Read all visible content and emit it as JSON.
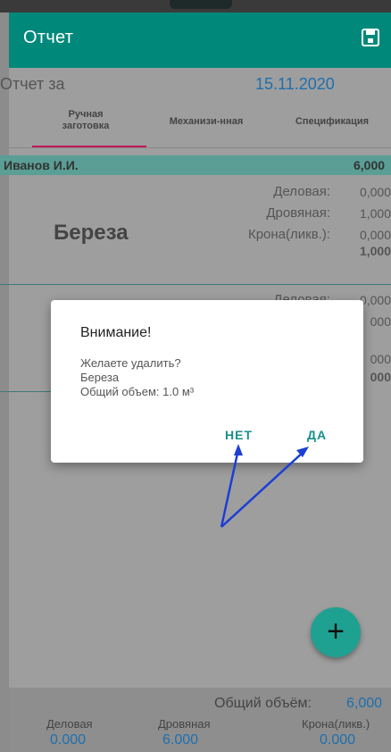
{
  "app_bar": {
    "title": "Отчет",
    "save_icon": "save-icon"
  },
  "report": {
    "label": "Отчет за",
    "date": "15.11.2020"
  },
  "tabs": [
    {
      "label": "Ручная\nзаготовка",
      "active": true
    },
    {
      "label": "Механизи-нная",
      "active": false
    },
    {
      "label": "Спецификация",
      "active": false
    }
  ],
  "worker": {
    "name": "Иванов И.И.",
    "total": "6,000"
  },
  "entries": [
    {
      "species": "Береза",
      "rows": [
        {
          "label": "Деловая:",
          "value": "0,000"
        },
        {
          "label": "Дровяная:",
          "value": "1,000"
        },
        {
          "label": "Крона(ликв.):",
          "value": "0,000"
        }
      ],
      "total": "1,000"
    },
    {
      "species": "",
      "rows": [
        {
          "label": "Деловая:",
          "value": "0,000"
        },
        {
          "label": "",
          "value": "000"
        },
        {
          "label": "",
          "value": "000"
        }
      ],
      "total": "000"
    }
  ],
  "dialog": {
    "title": "Внимание!",
    "message": "Желаете удалить?\nБереза\nОбщий объем: 1.0 м³",
    "no_label": "НЕТ",
    "yes_label": "ДА"
  },
  "fab": {
    "label": "+"
  },
  "summary": {
    "total_label": "Общий объём:",
    "total_value": "6,000",
    "columns": [
      {
        "label": "Деловая",
        "value": "0.000"
      },
      {
        "label": "Дровяная",
        "value": "6.000"
      },
      {
        "label": "Крона(ликв.)",
        "value": "0.000"
      }
    ]
  },
  "colors": {
    "accent": "#00897b",
    "dialog_button": "#1a8f8a",
    "date": "#1e6fae",
    "arrow": "#1c3fd6"
  }
}
